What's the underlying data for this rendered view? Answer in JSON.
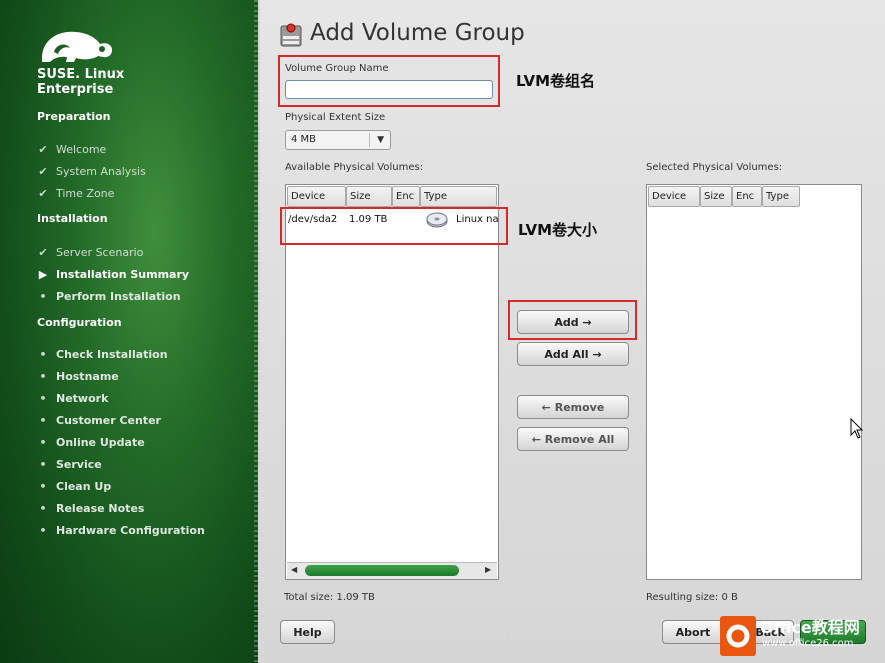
{
  "brand": {
    "line1": "SUSE. Linux",
    "line2": "Enterprise"
  },
  "sidebar": {
    "sections": [
      {
        "label": "Preparation"
      },
      {
        "label": "Installation"
      },
      {
        "label": "Configuration"
      }
    ],
    "preparation": [
      "Welcome",
      "System Analysis",
      "Time Zone"
    ],
    "installation": [
      "Server Scenario",
      "Installation Summary",
      "Perform Installation"
    ],
    "configuration": [
      "Check Installation",
      "Hostname",
      "Network",
      "Customer Center",
      "Online Update",
      "Service",
      "Clean Up",
      "Release Notes",
      "Hardware Configuration"
    ]
  },
  "dialog": {
    "title": "Add Volume Group",
    "vg_name_label": "Volume Group Name",
    "vg_name_value": "",
    "pe_size_label": "Physical Extent Size",
    "pe_size_value": "4 MB",
    "available_label": "Available Physical Volumes:",
    "selected_label": "Selected Physical Volumes:",
    "columns": [
      "Device",
      "Size",
      "Enc",
      "Type"
    ],
    "available_rows": [
      {
        "device": "/dev/sda2",
        "size": "1.09 TB",
        "enc": "",
        "type": "Linux na"
      }
    ],
    "total_size": "Total size: 1.09 TB",
    "resulting_size": "Resulting size: 0 B",
    "buttons": {
      "add": "Add →",
      "add_all": "Add All →",
      "remove": "← Remove",
      "remove_all": "← Remove All"
    },
    "help": "Help",
    "abort": "Abort",
    "back": "Back"
  },
  "annotations": {
    "vg_name": "LVM卷组名",
    "vg_size": "LVM卷大小"
  },
  "watermark": {
    "title": "Office教程网",
    "url": "www.office26.com"
  },
  "colors": {
    "accent_green": "#1c7a2b",
    "annotation_red": "#d52a2a"
  }
}
